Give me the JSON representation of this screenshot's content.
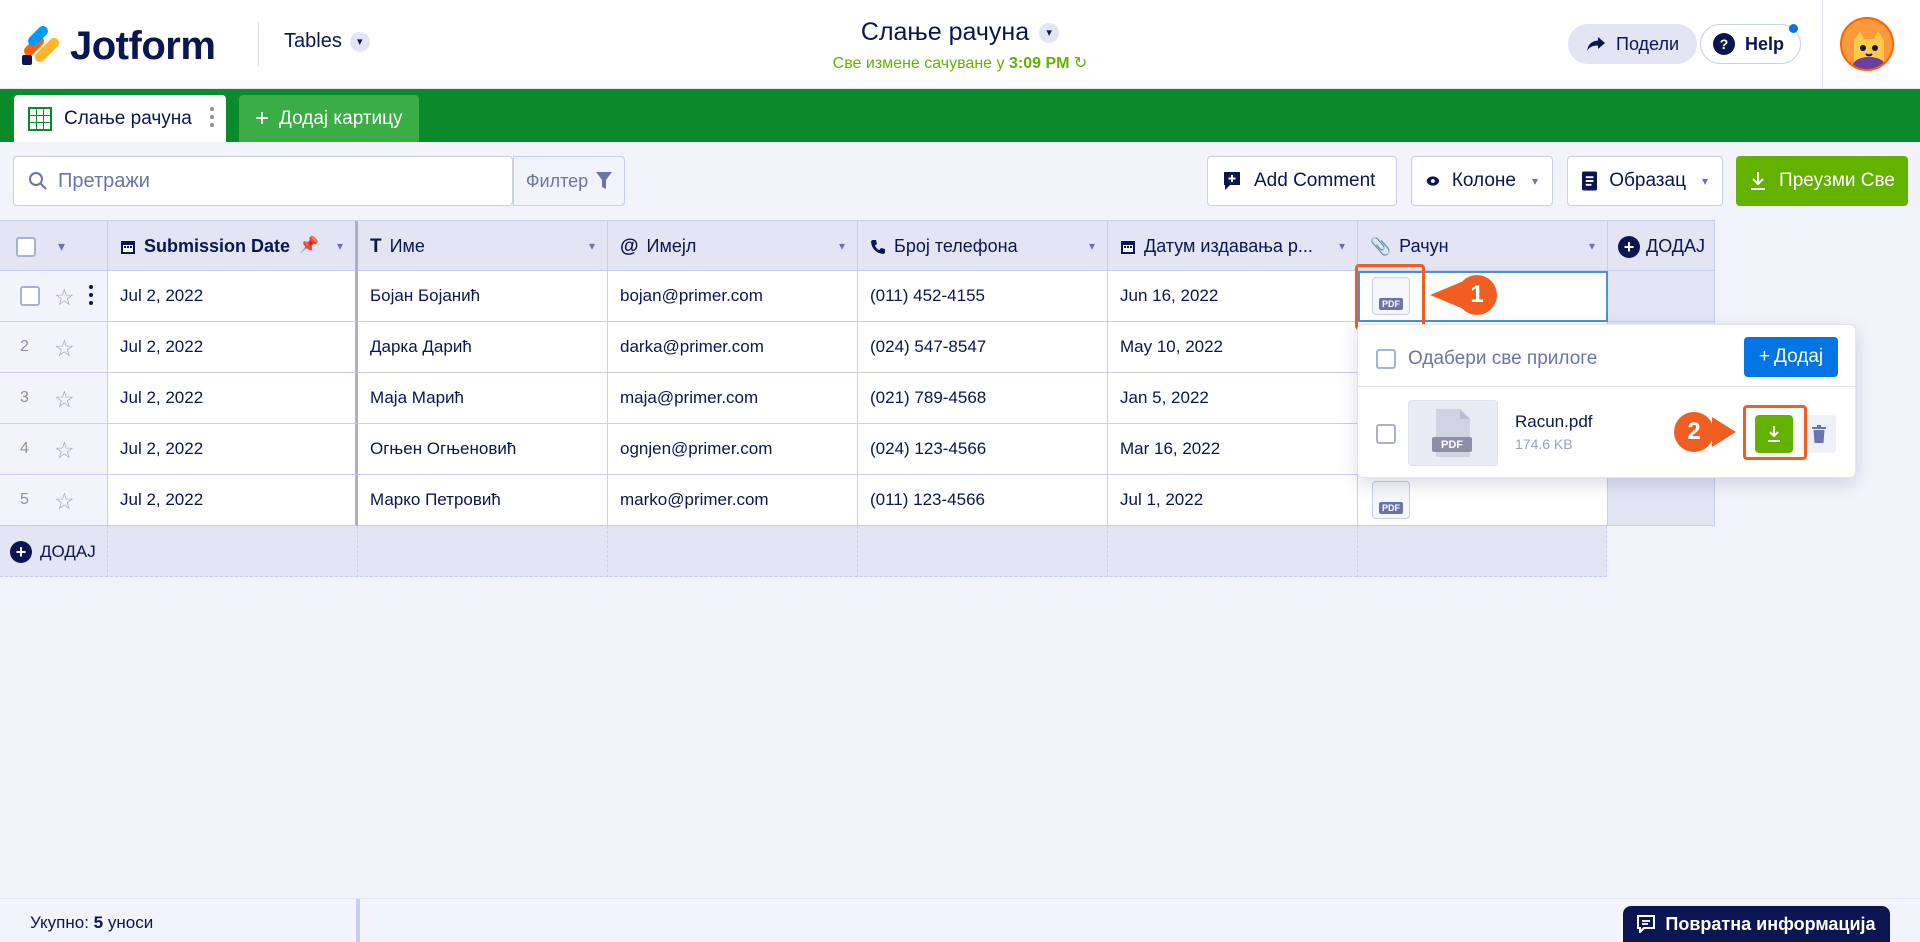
{
  "header": {
    "logo_text": "Jotform",
    "tables_label": "Tables",
    "doc_title": "Слање рачуна",
    "saved_prefix": "Све измене сачуване у",
    "saved_time": "3:09 PM",
    "share_label": "Подели",
    "help_label": "Help"
  },
  "tabs": {
    "active_label": "Слање рачуна",
    "add_label": "Додај картицу"
  },
  "toolbar": {
    "search_placeholder": "Претражи",
    "filter_label": "Филтер",
    "add_comment_label": "Add Comment",
    "columns_label": "Колоне",
    "form_label": "Образац",
    "download_all_label": "Преузми Све"
  },
  "table": {
    "columns": [
      "Submission Date",
      "Име",
      "Имејл",
      "Број телефона",
      "Датум издавања р...",
      "Рачун"
    ],
    "add_column_label": "ДОДАЈ",
    "rows": [
      {
        "num": "",
        "date": "Jul 2, 2022",
        "name": "Бојан Бојанић",
        "email": "bojan@primer.com",
        "phone": "(011) 452-4155",
        "issued": "Jun 16, 2022"
      },
      {
        "num": "2",
        "date": "Jul 2, 2022",
        "name": "Дарка Дарић",
        "email": "darka@primer.com",
        "phone": "(024) 547-8547",
        "issued": "May 10, 2022"
      },
      {
        "num": "3",
        "date": "Jul 2, 2022",
        "name": "Маја Марић",
        "email": "maja@primer.com",
        "phone": "(021) 789-4568",
        "issued": "Jan 5, 2022"
      },
      {
        "num": "4",
        "date": "Jul 2, 2022",
        "name": "Огњен Огњеновић",
        "email": "ognjen@primer.com",
        "phone": "(024) 123-4566",
        "issued": "Mar 16, 2022"
      },
      {
        "num": "5",
        "date": "Jul 2, 2022",
        "name": "Марко Петровић",
        "email": "marko@primer.com",
        "phone": "(011) 123-4566",
        "issued": "Jul 1, 2022"
      }
    ],
    "add_row_label": "ДОДАЈ",
    "pdf_tag": "PDF"
  },
  "popover": {
    "select_all_label": "Одабери све прилоге",
    "add_label": "Додај",
    "file_name": "Racun.pdf",
    "file_size": "174.6 KB",
    "file_tag": "PDF"
  },
  "annotations": {
    "badge1": "1",
    "badge2": "2",
    "color": "#f05f22"
  },
  "footer": {
    "total_label": "Укупно:",
    "total_count": "5",
    "total_unit": "уноси",
    "feedback_label": "Повратна информација"
  },
  "colors": {
    "brand_navy": "#0a1551",
    "tab_green": "#0a8a2b",
    "action_green": "#64b200",
    "accent_blue": "#0075e3"
  }
}
